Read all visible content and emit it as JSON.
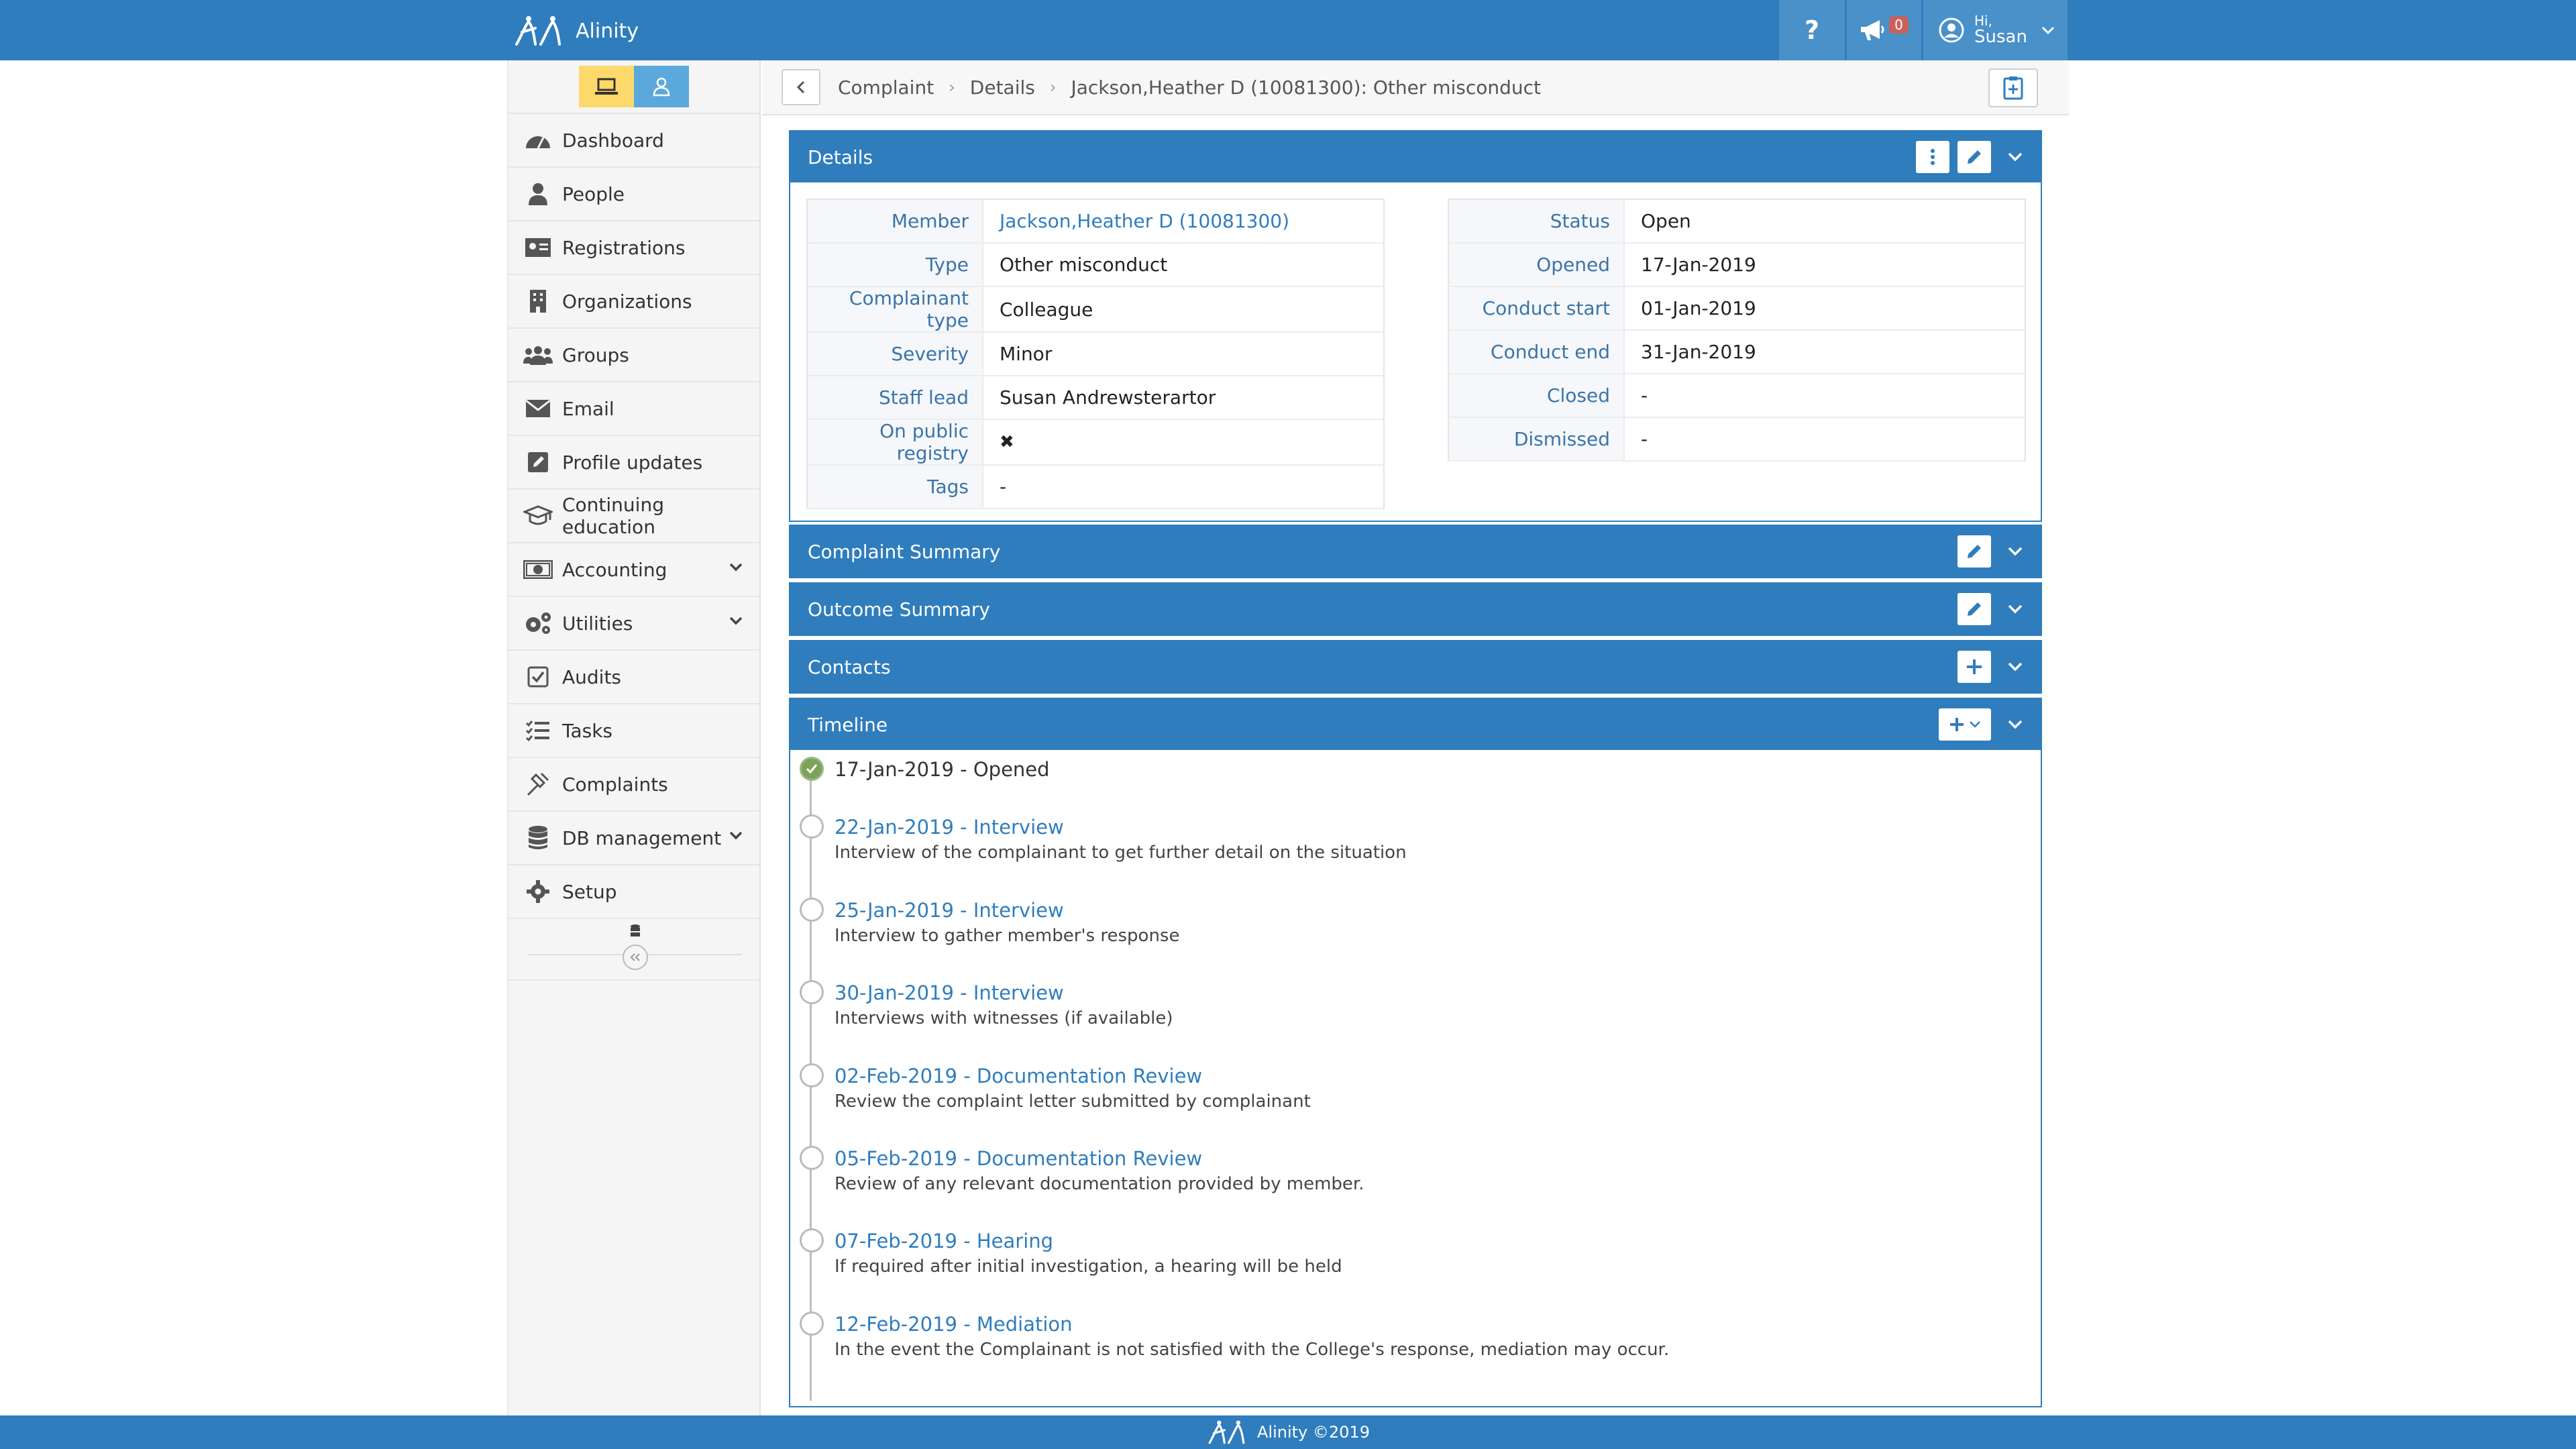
{
  "app": {
    "name": "Alinity"
  },
  "header": {
    "help_label": "?",
    "notifications_count": "0",
    "greeting": "Hi,",
    "user_name": "Susan"
  },
  "sidebar": {
    "items": [
      {
        "label": "Dashboard",
        "icon": "dashboard-icon"
      },
      {
        "label": "People",
        "icon": "person-icon"
      },
      {
        "label": "Registrations",
        "icon": "id-card-icon"
      },
      {
        "label": "Organizations",
        "icon": "building-icon"
      },
      {
        "label": "Groups",
        "icon": "users-icon"
      },
      {
        "label": "Email",
        "icon": "envelope-icon"
      },
      {
        "label": "Profile updates",
        "icon": "edit-icon"
      },
      {
        "label": "Continuing education",
        "icon": "graduation-cap-icon"
      },
      {
        "label": "Accounting",
        "icon": "money-icon"
      },
      {
        "label": "Utilities",
        "icon": "cogs-icon"
      },
      {
        "label": "Audits",
        "icon": "checkbox-icon"
      },
      {
        "label": "Tasks",
        "icon": "tasks-icon"
      },
      {
        "label": "Complaints",
        "icon": "gavel-icon"
      },
      {
        "label": "DB management",
        "icon": "database-icon"
      },
      {
        "label": "Setup",
        "icon": "gear-icon"
      }
    ]
  },
  "breadcrumb": [
    "Complaint",
    "Details",
    "Jackson,Heather D (10081300): Other misconduct"
  ],
  "details": {
    "title": "Details",
    "left": [
      {
        "label": "Member",
        "value": "Jackson,Heather D (10081300)"
      },
      {
        "label": "Type",
        "value": "Other misconduct"
      },
      {
        "label": "Complainant type",
        "value": "Colleague"
      },
      {
        "label": "Severity",
        "value": "Minor"
      },
      {
        "label": "Staff lead",
        "value": "Susan Andrewsterartor"
      },
      {
        "label": "On public registry",
        "value": "✖"
      },
      {
        "label": "Tags",
        "value": "-"
      }
    ],
    "right": [
      {
        "label": "Status",
        "value": "Open"
      },
      {
        "label": "Opened",
        "value": "17-Jan-2019"
      },
      {
        "label": "Conduct start",
        "value": "01-Jan-2019"
      },
      {
        "label": "Conduct end",
        "value": "31-Jan-2019"
      },
      {
        "label": "Closed",
        "value": "-"
      },
      {
        "label": "Dismissed",
        "value": "-"
      }
    ]
  },
  "sections": {
    "complaint_summary": "Complaint Summary",
    "outcome_summary": "Outcome Summary",
    "contacts": "Contacts",
    "timeline": "Timeline"
  },
  "timeline": [
    {
      "title": "17-Jan-2019 - Opened",
      "desc": "",
      "done": true
    },
    {
      "title": "22-Jan-2019 - Interview",
      "desc": "Interview of the complainant to get further detail on the situation"
    },
    {
      "title": "25-Jan-2019 - Interview",
      "desc": "Interview to gather member's response"
    },
    {
      "title": "30-Jan-2019 - Interview",
      "desc": "Interviews with witnesses (if available)"
    },
    {
      "title": "02-Feb-2019 - Documentation Review",
      "desc": "Review the complaint letter submitted by complainant"
    },
    {
      "title": "05-Feb-2019 - Documentation Review",
      "desc": "Review of any relevant documentation provided by member."
    },
    {
      "title": "07-Feb-2019 - Hearing",
      "desc": "If required after initial investigation, a hearing will be held"
    },
    {
      "title": "12-Feb-2019 - Mediation",
      "desc": "In the event the Complainant is not satisfied with the College's response, mediation may occur."
    }
  ],
  "footer": {
    "text": "Alinity ©2019"
  },
  "colors": {
    "primary": "#2f7dbd",
    "accent_yellow": "#fcd96a",
    "accent_blue": "#5ba8dc",
    "done_green": "#7da35a"
  }
}
